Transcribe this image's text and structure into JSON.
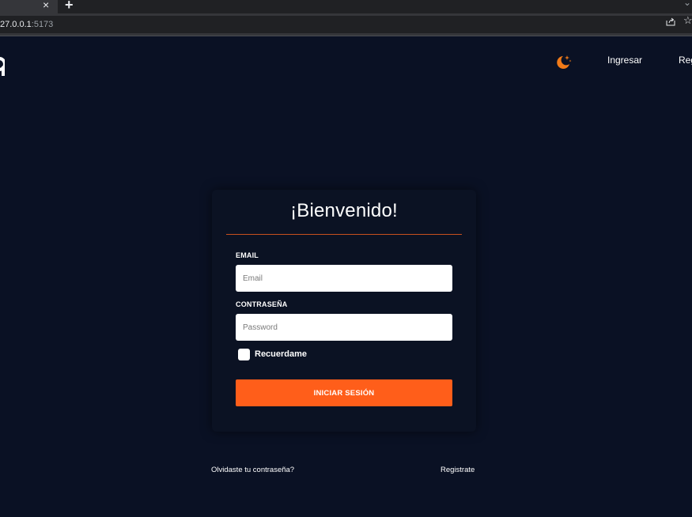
{
  "browser": {
    "tab_close_glyph": "×",
    "new_tab_glyph": "+",
    "tab_menu_glyph": "⌄",
    "url_host": "27.0.0.1",
    "url_port": ":5173",
    "share_icon": "share-icon",
    "bookmark_icon": "star-icon"
  },
  "header": {
    "logo_icon": "logo-icon",
    "theme_icon": "moon-stars-icon",
    "nav_login": "Ingresar",
    "nav_register": "Reg"
  },
  "login": {
    "title": "¡Bienvenido!",
    "email_label": "EMAIL",
    "email_placeholder": "Email",
    "email_value": "",
    "password_label": "CONTRASEÑA",
    "password_placeholder": "Password",
    "password_value": "",
    "remember_label": "Recuerdame",
    "remember_checked": false,
    "submit_label": "INICIAR SESIÓN"
  },
  "footer": {
    "forgot_password": "Olvidaste tu contraseña?",
    "register": "Registrate"
  },
  "colors": {
    "background": "#0a1124",
    "accent": "#ff5e1a",
    "divider": "#c8501e",
    "text": "#ffffff"
  }
}
